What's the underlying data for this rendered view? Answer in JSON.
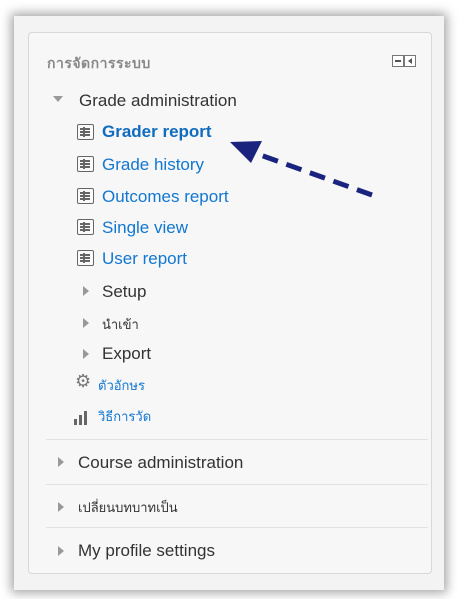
{
  "header": {
    "title": "การจัดการระบบ"
  },
  "grade_admin": {
    "label": "Grade administration",
    "reports": [
      {
        "label": "Grader report"
      },
      {
        "label": "Grade history"
      },
      {
        "label": "Outcomes report"
      },
      {
        "label": "Single view"
      },
      {
        "label": "User report"
      }
    ],
    "folders": [
      {
        "label": "Setup"
      },
      {
        "label": "นำเข้า"
      },
      {
        "label": "Export"
      }
    ],
    "letters": "ตัวอักษร",
    "scales": "วิธีการวัด"
  },
  "sections": [
    {
      "label": "Course administration"
    },
    {
      "label": "เปลี่ยนบทบาทเป็น"
    },
    {
      "label": "My profile settings"
    }
  ],
  "colors": {
    "link": "#1177d1",
    "arrow": "#1a237e"
  }
}
